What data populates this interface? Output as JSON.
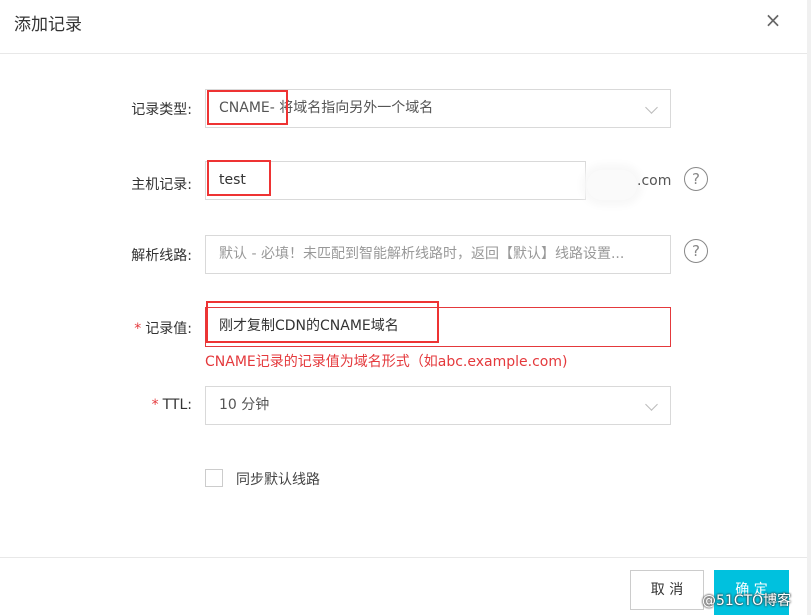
{
  "dialog": {
    "title": "添加记录",
    "close_glyph": "×"
  },
  "form": {
    "record_type": {
      "label": "记录类型:",
      "value": "CNAME- 将域名指向另外一个域名"
    },
    "host": {
      "label": "主机记录:",
      "value": "test",
      "suffix": ".com"
    },
    "line": {
      "label": "解析线路:",
      "value": "默认 - 必填！未匹配到智能解析线路时，返回【默认】线路设置..."
    },
    "record_value": {
      "required_mark": "*",
      "label": "记录值:",
      "value": "刚才复制CDN的CNAME域名",
      "error": "CNAME记录的记录值为域名形式（如abc.example.com)"
    },
    "ttl": {
      "required_mark": "*",
      "label": "TTL:",
      "value": "10 分钟"
    },
    "sync_default_line": {
      "label": "同步默认线路",
      "checked": false
    }
  },
  "help_glyph": "?",
  "buttons": {
    "cancel": "取 消",
    "ok": "确 定"
  },
  "watermark": "@51CTO博客",
  "colors": {
    "accent": "#00c1de",
    "error": "#e4393c",
    "highlight": "#e33333"
  }
}
